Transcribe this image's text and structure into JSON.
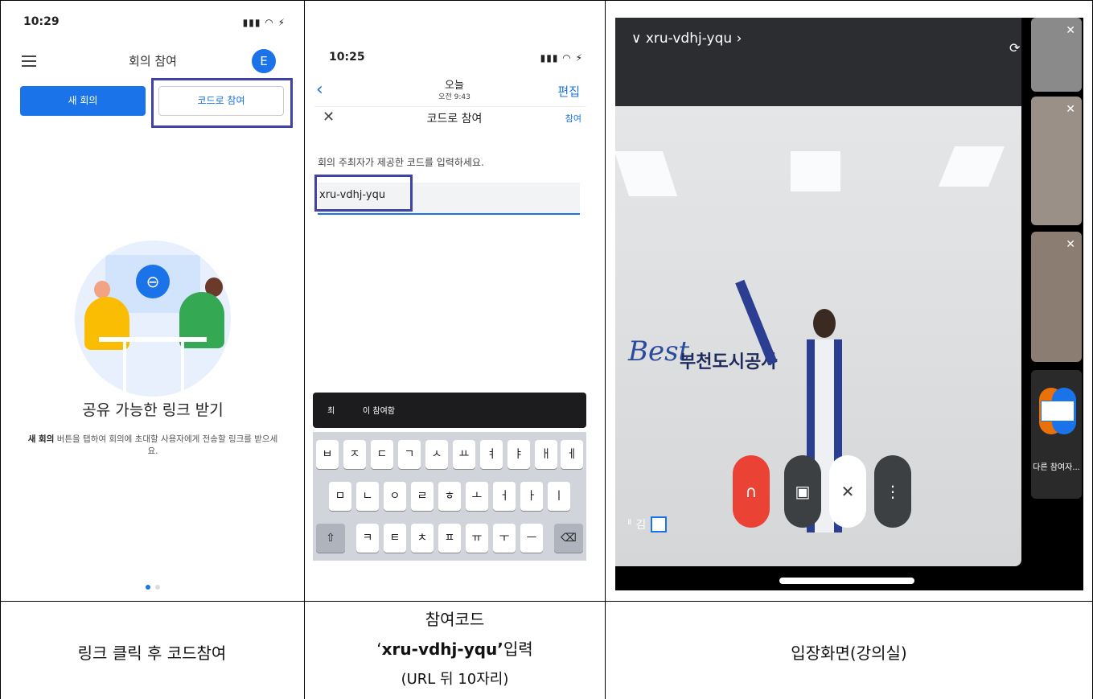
{
  "panel1": {
    "status_time": "10:29",
    "status_icons": "▮▮▮ ◠ ⚡",
    "title": "회의 참여",
    "avatar_initial": "E",
    "new_meeting_label": "새 회의",
    "join_with_code_label": "코드로 참여",
    "heading": "공유 가능한 링크 받기",
    "desc_bold": "새 회의",
    "desc_text": " 버튼을 탭하여 회의에 초대할 사용자에게 전송할 링크를 받으세요."
  },
  "panel2": {
    "status_time": "10:25",
    "status_icons": "▮▮▮ ◠ ⚡",
    "back": "‹",
    "date_main": "오늘",
    "date_sub": "오전 9:43",
    "edit": "편집",
    "close": "✕",
    "sheet_title": "코드로 참여",
    "join_link": "참여",
    "instruction": "회의 주최자가 제공한 코드를 입력하세요.",
    "code_value": "xru-vdhj-yqu",
    "suggest_1": "최",
    "suggest_2": "이 참여함",
    "keys_row1": [
      "ㅂ",
      "ㅈ",
      "ㄷ",
      "ㄱ",
      "ㅅ",
      "ㅛ",
      "ㅕ",
      "ㅑ",
      "ㅐ",
      "ㅔ"
    ],
    "keys_row2": [
      "ㅁ",
      "ㄴ",
      "ㅇ",
      "ㄹ",
      "ㅎ",
      "ㅗ",
      "ㅓ",
      "ㅏ",
      "ㅣ"
    ],
    "keys_row3": [
      "ㅋ",
      "ㅌ",
      "ㅊ",
      "ㅍ",
      "ㅠ",
      "ㅜ",
      "ㅡ"
    ],
    "shift_key": "⇧",
    "delete_key": "⌫"
  },
  "panel3": {
    "meeting_code": "∨   xru-vdhj-yqu ›",
    "wall_logo": "Best",
    "wall_text": "부천도시공사",
    "others_label": "다른 참여자...",
    "speaker_name": "ᅵᅵ 김",
    "mic_off_icon": "✕"
  },
  "captions": {
    "col1": "링크 클릭 후 코드참여",
    "col2_line1": "참여코드",
    "col2_line2_pre": "‘",
    "col2_line2_bold": "xru-vdhj-yqu’",
    "col2_line2_post": "입력",
    "col2_line3": "(URL 뒤 10자리)",
    "col3": "입장화면(강의실)"
  },
  "colors": {
    "accent": "#1a73e8",
    "highlight_border": "#3f43a6",
    "end_call": "#ea4335"
  }
}
